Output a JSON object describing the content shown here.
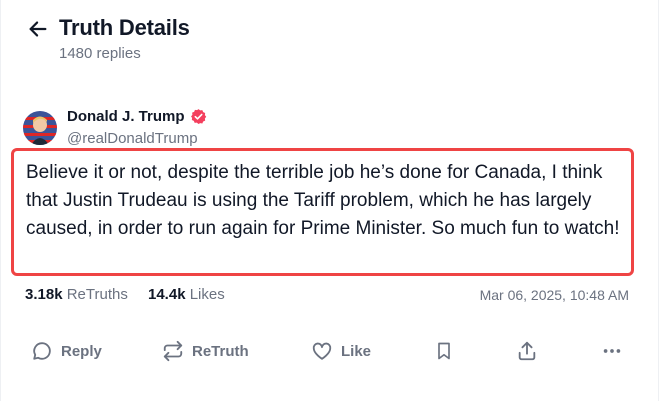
{
  "header": {
    "title": "Truth Details",
    "replies": "1480 replies"
  },
  "author": {
    "name": "Donald J. Trump",
    "handle": "@realDonaldTrump",
    "verified": true
  },
  "post": {
    "text": "Believe it or not, despite the terrible job he’s done for Canada, I think that Justin Trudeau is using the Tariff problem, which he has largely caused, in order to run again for Prime Minister. So much fun to watch!"
  },
  "stats": {
    "retruths_count": "3.18k",
    "retruths_label": "ReTruths",
    "likes_count": "14.4k",
    "likes_label": "Likes",
    "date": "Mar 06, 2025, 10:48 AM"
  },
  "actions": {
    "reply": "Reply",
    "retruth": "ReTruth",
    "like": "Like"
  },
  "colors": {
    "highlight_border": "#ef4444",
    "verified_badge": "#f43f5e",
    "muted_text": "#6b7280"
  }
}
